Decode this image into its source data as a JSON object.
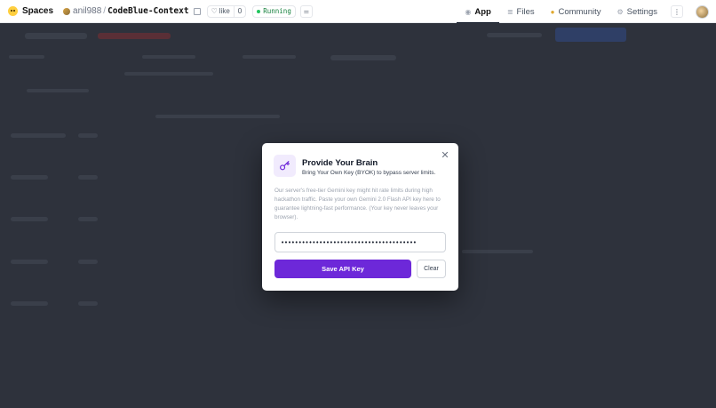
{
  "header": {
    "brand_label": "Spaces",
    "owner": "anil988",
    "separator": "/",
    "repo_name": "CodeBlue-Context",
    "like_label": "like",
    "like_count": "0",
    "status_label": "Running",
    "nav": [
      {
        "label": "App",
        "icon": "app-icon",
        "active": true
      },
      {
        "label": "Files",
        "icon": "files-icon",
        "active": false
      },
      {
        "label": "Community",
        "icon": "community-icon",
        "active": false
      },
      {
        "label": "Settings",
        "icon": "gear-icon",
        "active": false
      }
    ],
    "more_glyph": "⋮"
  },
  "modal": {
    "title": "Provide Your Brain",
    "subtitle": "Bring Your Own Key (BYOK) to bypass server limits.",
    "description": "Our server's free-tier Gemini key might hit rate limits during high hackathon traffic. Paste your own Gemini 2.0 Flash API key here to guarantee lightning-fast performance. (Your key never leaves your browser).",
    "api_key_value": "•••••••••••••••••••••••••••••••••••••••",
    "save_label": "Save API Key",
    "clear_label": "Clear",
    "close_glyph": "✕"
  },
  "colors": {
    "accent": "#6d28d9",
    "backdrop": "#2e323c",
    "running": "#22c55e"
  }
}
